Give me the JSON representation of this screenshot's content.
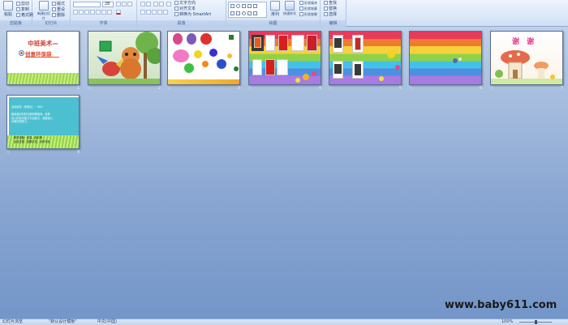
{
  "ribbon": {
    "groups": [
      {
        "label": "剪贴板",
        "buttons": [
          "粘贴"
        ],
        "small": [
          "剪切",
          "复制",
          "格式刷"
        ]
      },
      {
        "label": "幻灯片",
        "buttons": [
          "新建幻灯片"
        ],
        "small": [
          "版式",
          "重设",
          "删除"
        ]
      },
      {
        "label": "字体",
        "font_value": "",
        "size_value": "28"
      },
      {
        "label": "段落",
        "small": [
          "文字方向",
          "对齐文本",
          "转换为 SmartArt"
        ]
      },
      {
        "label": "绘图",
        "buttons": [
          "排列",
          "快速样式"
        ],
        "small": [
          "形状填充",
          "形状轮廓",
          "形状效果"
        ]
      },
      {
        "label": "编辑",
        "small": [
          "查找",
          "替换",
          "选择"
        ]
      }
    ]
  },
  "slides": [
    {
      "number": "1",
      "title": "中班美术—",
      "subtitle": "创意环保袋"
    },
    {
      "number": "2"
    },
    {
      "number": "3"
    },
    {
      "number": "4"
    },
    {
      "number": "5"
    },
    {
      "number": "6"
    },
    {
      "number": "7"
    },
    {
      "number": "8",
      "title": "谢 谢"
    },
    {
      "number": "9",
      "lines": [
        "活动目标（重难点）：XXX",
        "能用废旧材料与颜料等装饰，培养",
        "幼儿的动手能力与创造力，发展幼儿",
        "对美的感受力。",
        "",
        "教学准备：纸袋，颜料等",
        "活动过程：观察示范，创作作品"
      ]
    }
  ],
  "status": {
    "view": "幻灯片浏览",
    "theme": "\"默认设计模板\"",
    "language": "中文(中国)",
    "zoom": "100%"
  },
  "watermark": "www.baby611.com",
  "colors": {
    "ribbon_bg": "#dde9f8",
    "canvas_top": "#c9d8ec",
    "canvas_bottom": "#7295c8"
  }
}
